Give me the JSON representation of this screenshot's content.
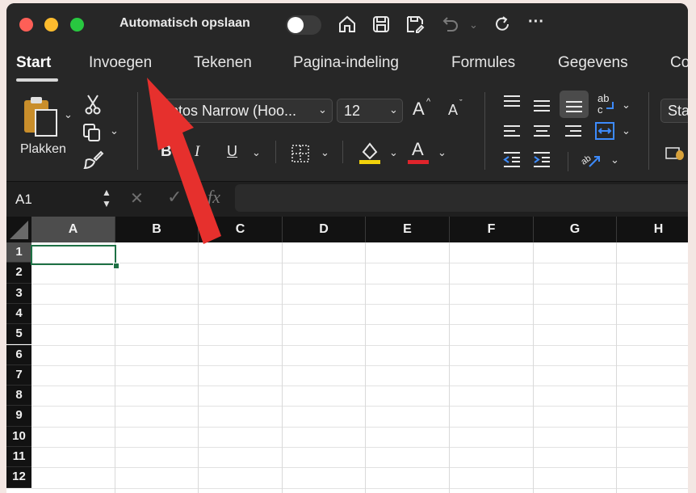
{
  "titlebar": {
    "autosave_label": "Automatisch opslaan",
    "more_label": "···"
  },
  "tabs": [
    "Start",
    "Invoegen",
    "Tekenen",
    "Pagina-indeling",
    "Formules",
    "Gegevens",
    "Co"
  ],
  "ribbon": {
    "paste_label": "Plakken",
    "font_name": "Aptos Narrow (Hoo...",
    "font_size": "12",
    "bold": "B",
    "italic": "I",
    "underline": "U",
    "grow_font": "A",
    "shrink_font": "A",
    "font_color_glyph": "A",
    "styles_partial": "Sta",
    "highlight_color": "#f2d20b",
    "font_color": "#e0242b"
  },
  "formula_bar": {
    "cell_ref": "A1",
    "cancel_glyph": "✕",
    "enter_glyph": "✓",
    "fx_label": "fx"
  },
  "grid": {
    "columns": [
      "A",
      "B",
      "C",
      "D",
      "E",
      "F",
      "G",
      "H"
    ],
    "rows": [
      "1",
      "2",
      "3",
      "4",
      "5",
      "6",
      "7",
      "8",
      "9",
      "10",
      "11",
      "12"
    ]
  },
  "annotation": {
    "arrow_color": "#e6302d"
  }
}
